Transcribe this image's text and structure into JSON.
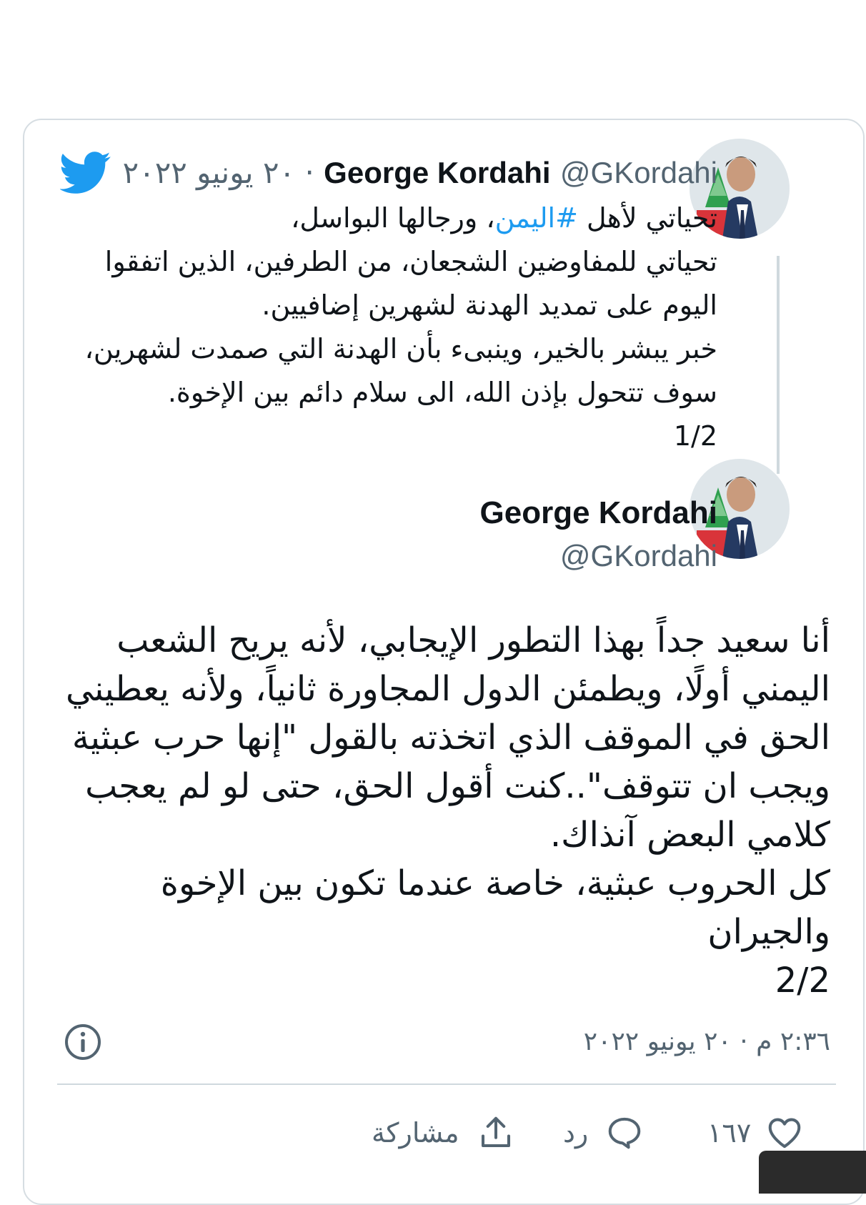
{
  "parent_tweet": {
    "name": "George Kordahi",
    "handle": "@GKordahi",
    "separator": "·",
    "date": "٢٠ يونيو ٢٠٢٢",
    "text_before_hashtag": "تحياتي لأهل ",
    "hashtag": "#اليمن",
    "text_after_hashtag": "، ورجالها البواسل،\nتحياتي للمفاوضين الشجعان، من الطرفين، الذين اتفقوا اليوم على تمديد الهدنة لشهرين إضافيين.\nخبر يبشر بالخير، وينبىء بأن الهدنة التي صمدت لشهرين، سوف تتحول بإذن الله، الى سلام دائم بين الإخوة.\n1/2"
  },
  "main_tweet": {
    "name": "George Kordahi",
    "handle": "@GKordahi",
    "text": "أنا سعيد جداً بهذا التطور الإيجابي، لأنه يريح الشعب اليمني أولًا، ويطمئن الدول المجاورة ثانياً، ولأنه يعطيني الحق في الموقف الذي اتخذته بالقول \"إنها حرب عبثية ويجب ان تتوقف\"..كنت أقول الحق، حتى لو لم يعجب كلامي البعض آنذاك.\nكل الحروب عبثية، خاصة عندما تكون بين الإخوة والجيران\n2/2",
    "timestamp": "٢:٣٦ م · ٢٠ يونيو ٢٠٢٢"
  },
  "actions": {
    "like_count": "١٦٧",
    "reply_label": "رد",
    "share_label": "مشاركة"
  },
  "icons": {
    "brand": "twitter-bird-icon",
    "info": "info-icon",
    "like": "heart-icon",
    "reply": "comment-bubble-icon",
    "share": "share-upload-icon"
  },
  "colors": {
    "brand_blue": "#1d9bf0",
    "text_primary": "#0f1419",
    "text_secondary": "#536471",
    "border": "#d6dde2"
  }
}
